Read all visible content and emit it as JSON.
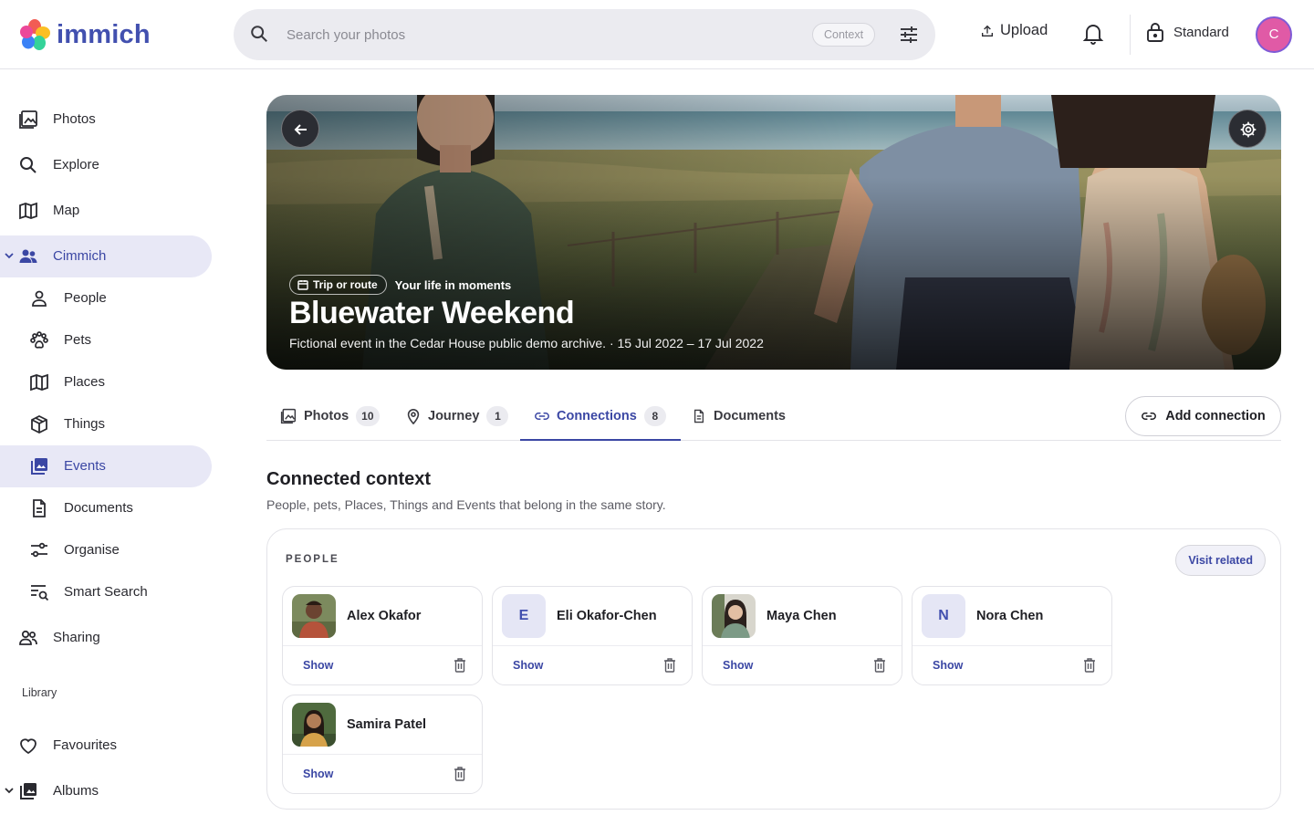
{
  "app": {
    "name": "immich"
  },
  "search": {
    "placeholder": "Search your photos",
    "context_chip": "Context"
  },
  "header": {
    "upload_label": "Upload",
    "account_label": "Standard",
    "avatar_initial": "C"
  },
  "sidebar": {
    "items": [
      {
        "label": "Photos",
        "icon": "photos-icon"
      },
      {
        "label": "Explore",
        "icon": "search-icon"
      },
      {
        "label": "Map",
        "icon": "map-icon"
      },
      {
        "label": "Cimmich",
        "icon": "people-group-icon"
      },
      {
        "label": "People",
        "icon": "person-icon"
      },
      {
        "label": "Pets",
        "icon": "paw-icon"
      },
      {
        "label": "Places",
        "icon": "map-icon"
      },
      {
        "label": "Things",
        "icon": "cube-icon"
      },
      {
        "label": "Events",
        "icon": "image-stack-icon"
      },
      {
        "label": "Documents",
        "icon": "document-icon"
      },
      {
        "label": "Organise",
        "icon": "sliders-icon"
      },
      {
        "label": "Smart Search",
        "icon": "list-search-icon"
      },
      {
        "label": "Sharing",
        "icon": "share-people-icon"
      }
    ],
    "library_label": "Library",
    "library_items": [
      {
        "label": "Favourites",
        "icon": "heart-icon"
      },
      {
        "label": "Albums",
        "icon": "album-icon"
      }
    ]
  },
  "hero": {
    "chip_label": "Trip or route",
    "tagline": "Your life in moments",
    "title": "Bluewater Weekend",
    "subtitle": "Fictional event in the Cedar House public demo archive. · 15 Jul 2022 – 17 Jul 2022"
  },
  "tabs": [
    {
      "label": "Photos",
      "count": "10"
    },
    {
      "label": "Journey",
      "count": "1"
    },
    {
      "label": "Connections",
      "count": "8"
    },
    {
      "label": "Documents",
      "count": ""
    }
  ],
  "add_connection_label": "Add connection",
  "context": {
    "title": "Connected context",
    "description": "People, pets, Places, Things and Events that belong in the same story.",
    "section_label": "PEOPLE",
    "visit_label": "Visit related",
    "show_label": "Show",
    "people": [
      {
        "name": "Alex Okafor",
        "initial": ""
      },
      {
        "name": "Eli Okafor-Chen",
        "initial": "E"
      },
      {
        "name": "Maya Chen",
        "initial": ""
      },
      {
        "name": "Nora Chen",
        "initial": "N"
      },
      {
        "name": "Samira Patel",
        "initial": ""
      }
    ]
  },
  "colors": {
    "accent": "#3b47a4",
    "active_bg": "#e8e8f6",
    "avatar": "#e05aa6"
  }
}
